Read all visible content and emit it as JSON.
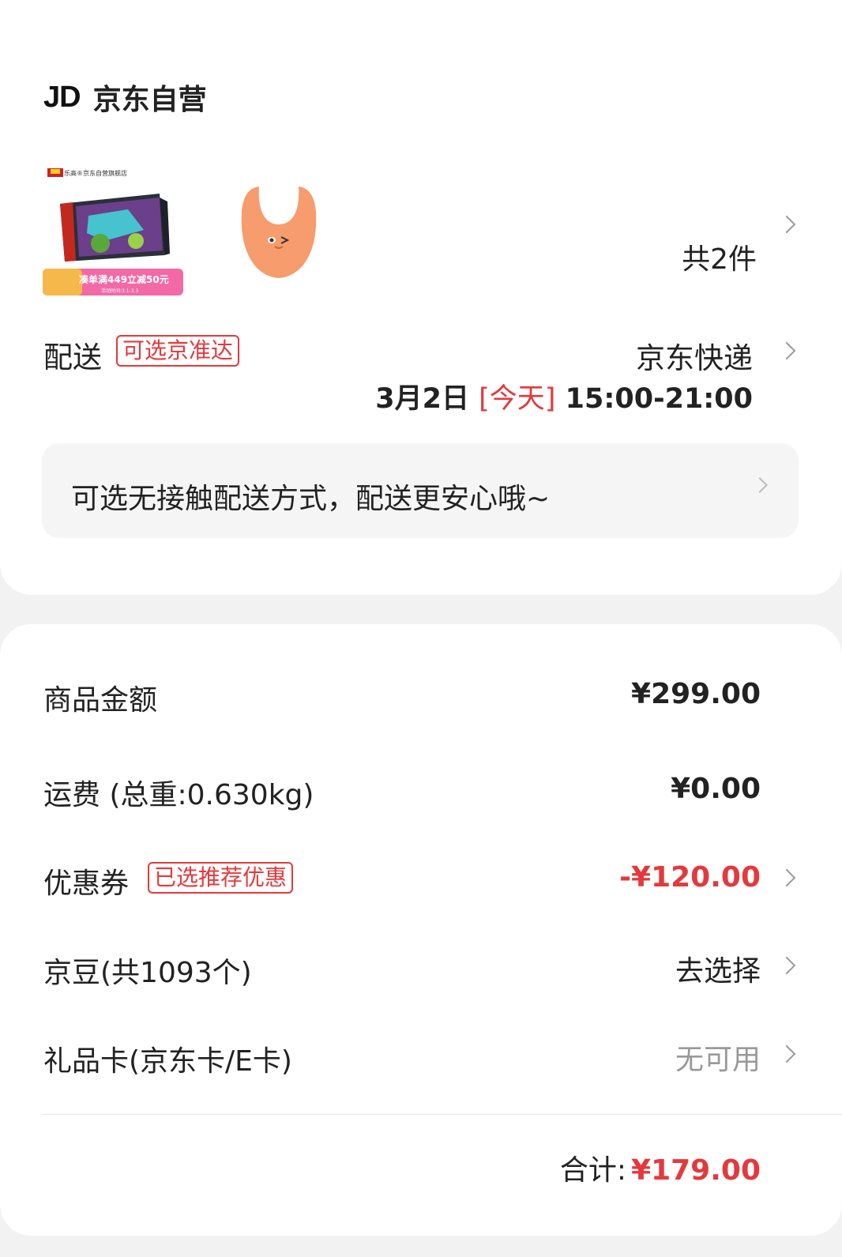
{
  "store": {
    "logo_text": "JD",
    "name": "京东自营"
  },
  "products": {
    "lego": {
      "shop_label": "乐高®京东自营旗舰店",
      "promo_text": "凑单满449立减50元",
      "promo_subtext": "活动时间:3.1-3.3"
    },
    "item_count": "共2件"
  },
  "delivery": {
    "label": "配送",
    "tag": "可选京准达",
    "method": "京东快递",
    "date": "3月2日",
    "today": "[今天]",
    "time_window": "15:00-21:00",
    "contactless_text": "可选无接触配送方式，配送更安心哦~"
  },
  "summary": {
    "goods_amount_label": "商品金额",
    "goods_amount_value": "¥299.00",
    "shipping_label": "运费",
    "shipping_weight": "(总重:0.630kg)",
    "shipping_value": "¥0.00",
    "coupon_label": "优惠券",
    "coupon_tag": "已选推荐优惠",
    "coupon_value": "-¥120.00",
    "jingdou_label": "京豆(共1093个)",
    "jingdou_value": "去选择",
    "giftcard_label": "礼品卡(京东卡/E卡)",
    "giftcard_value": "无可用",
    "total_label": "合计:",
    "total_value": "¥179.00"
  },
  "colors": {
    "accent_red": "#e4393c",
    "bib_orange": "#f79c6c"
  }
}
